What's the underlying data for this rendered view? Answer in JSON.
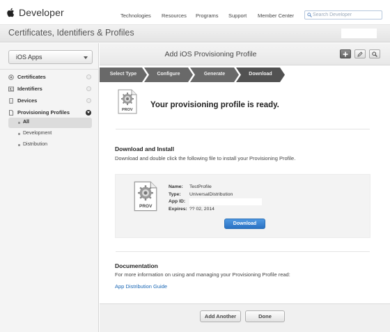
{
  "header": {
    "brand": "Developer",
    "nav": [
      "Technologies",
      "Resources",
      "Programs",
      "Support",
      "Member Center"
    ],
    "search_placeholder": "Search Developer"
  },
  "page_title": "Certificates, Identifiers & Profiles",
  "sidebar": {
    "app_select": "iOS Apps",
    "items": [
      {
        "label": "Certificates",
        "icon": "certificate-icon"
      },
      {
        "label": "Identifiers",
        "icon": "id-card-icon"
      },
      {
        "label": "Devices",
        "icon": "device-icon"
      },
      {
        "label": "Provisioning Profiles",
        "icon": "document-icon"
      }
    ],
    "sub_items": [
      "All",
      "Development",
      "Distribution"
    ],
    "active_sub": "All"
  },
  "content": {
    "title": "Add iOS Provisioning Profile",
    "toolbar": [
      "add-icon",
      "edit-icon",
      "search-icon"
    ],
    "steps": [
      "Select Type",
      "Configure",
      "Generate",
      "Download"
    ],
    "current_step": "Download",
    "ready_message": "Your provisioning profile is ready.",
    "prov_badge": "PROV",
    "download_install": {
      "heading": "Download and Install",
      "text": "Download and double click the following file to install your Provisioning Profile."
    },
    "profile": {
      "name_label": "Name:",
      "name": "TestProfile",
      "type_label": "Type:",
      "type": "UniversalDistribution",
      "appid_label": "App ID:",
      "appid": "",
      "expires_label": "Expires:",
      "expires": "?? 02, 2014",
      "download_button": "Download"
    },
    "documentation": {
      "heading": "Documentation",
      "text": "For more information on using and managing your Provisioning Profile read:",
      "link": "App Distribution Guide"
    },
    "footer": {
      "add_another": "Add Another",
      "done": "Done"
    }
  },
  "colors": {
    "step_bg": "#696969",
    "step_current": "#525252",
    "primary_button": "#2a72c3",
    "link": "#1a67b5"
  }
}
